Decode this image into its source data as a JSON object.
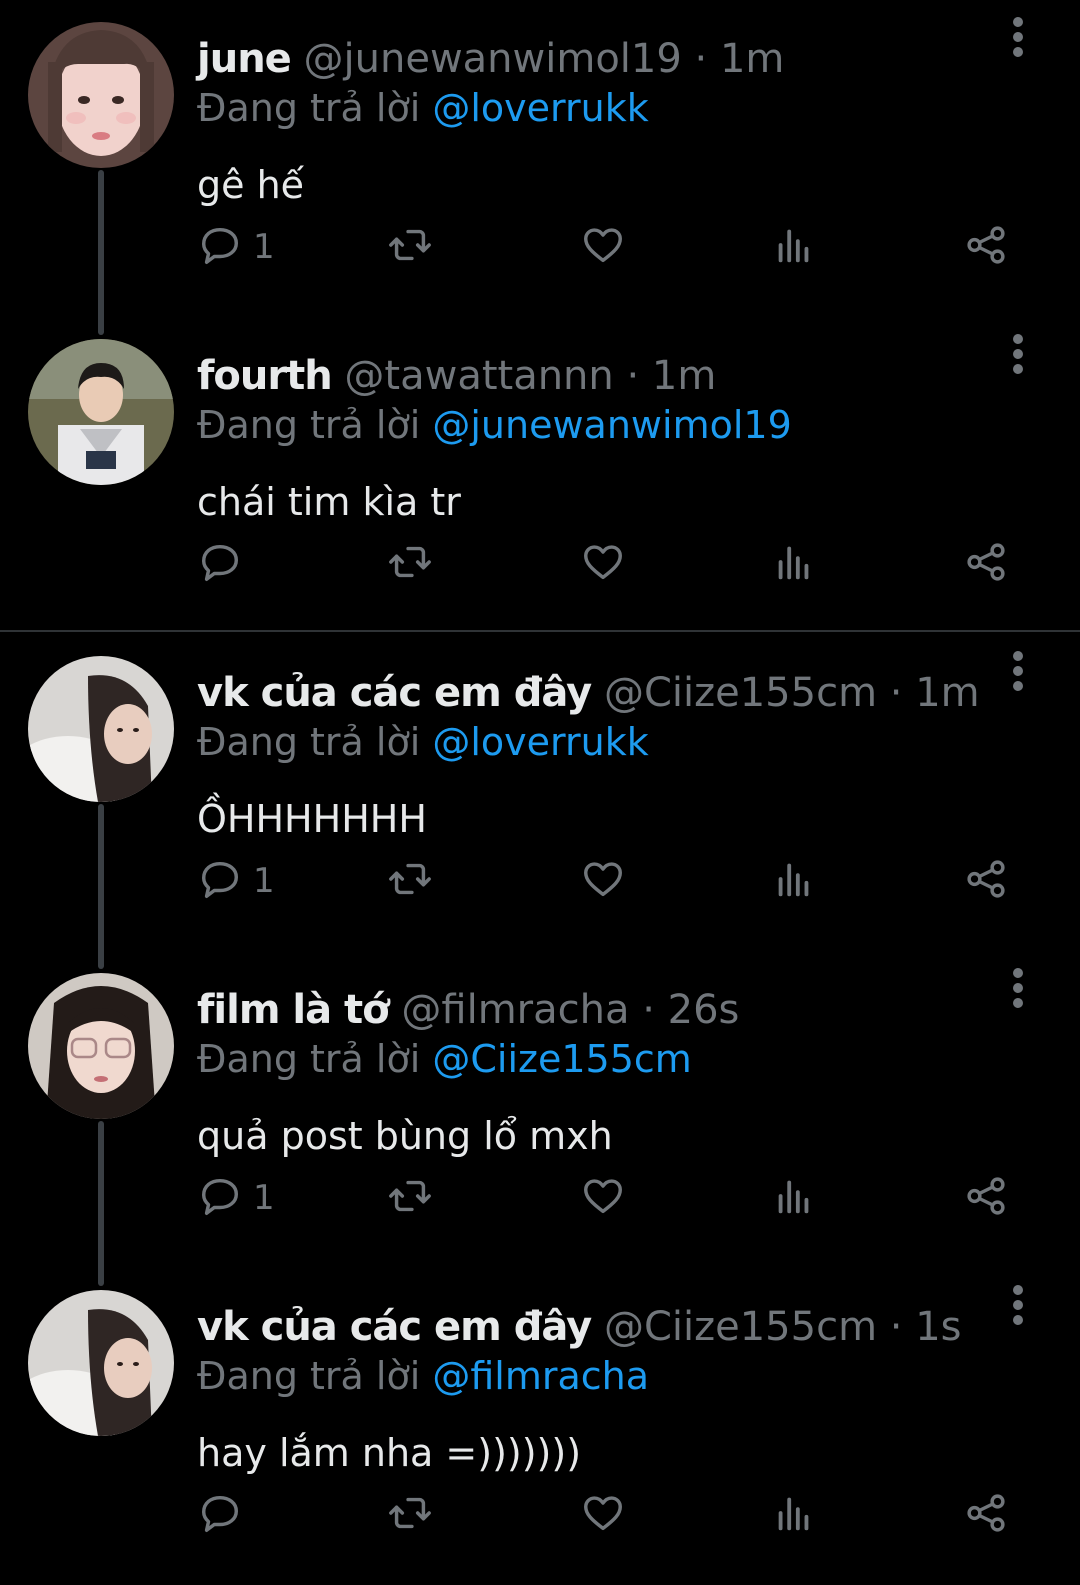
{
  "tweets": [
    {
      "name": "june",
      "handle": "@junewanwimol19",
      "time": "· 1m",
      "replying_label": "Đang trả lời",
      "replying_to": "@loverrukk",
      "text": "gê hế",
      "reply_count": "1"
    },
    {
      "name": "fourth",
      "handle": "@tawattannn",
      "time": "· 1m",
      "replying_label": "Đang trả lời",
      "replying_to": "@junewanwimol19",
      "text": "chái tim kìa tr",
      "reply_count": ""
    },
    {
      "name": "vk của các em đây",
      "handle": "@Ciize155cm",
      "time": "· 1m",
      "replying_label": "Đang trả lời",
      "replying_to": "@loverrukk",
      "text": "ỒHHHHHHH",
      "reply_count": "1"
    },
    {
      "name": "film là tớ",
      "handle": "@filmracha",
      "time": "· 26s",
      "replying_label": "Đang trả lời",
      "replying_to": "@Ciize155cm",
      "text": "quả post bùng lổ mxh",
      "reply_count": "1"
    },
    {
      "name": "vk của các em đây",
      "handle": "@Ciize155cm",
      "time": "· 1s",
      "replying_label": "Đang trả lời",
      "replying_to": "@filmracha",
      "text": "hay lắm nha =)))))))",
      "reply_count": ""
    }
  ],
  "icons": {
    "reply": "reply-icon",
    "retweet": "retweet-icon",
    "like": "heart-icon",
    "views": "views-icon",
    "share": "share-icon",
    "more": "more-vertical-icon"
  },
  "colors": {
    "background": "#000000",
    "text": "#e7e9ea",
    "secondary": "#71767b",
    "accent": "#1d9bf0",
    "thread_line": "#3a3f44",
    "divider": "#2f3336"
  }
}
